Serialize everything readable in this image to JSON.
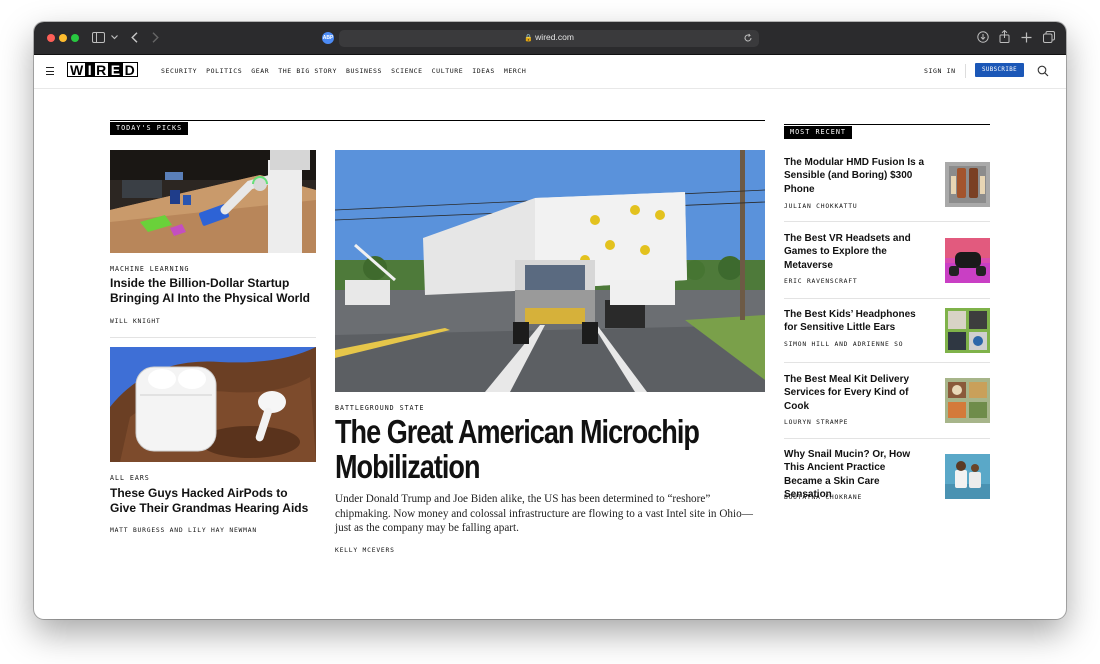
{
  "browser": {
    "url": "wired.com",
    "privacy_badge": "ABP"
  },
  "header": {
    "logo_letters": [
      "W",
      "I",
      "R",
      "E",
      "D"
    ],
    "nav": [
      "SECURITY",
      "POLITICS",
      "GEAR",
      "THE BIG STORY",
      "BUSINESS",
      "SCIENCE",
      "CULTURE",
      "IDEAS",
      "MERCH"
    ],
    "sign_in": "SIGN IN",
    "subscribe": "SUBSCRIBE"
  },
  "todays_picks": {
    "label": "TODAY'S PICKS",
    "stories": [
      {
        "kicker": "MACHINE LEARNING",
        "title": "Inside the Billion-Dollar Startup Bringing AI Into the Physical World",
        "byline": "WILL KNIGHT"
      },
      {
        "kicker": "ALL EARS",
        "title": "These Guys Hacked AirPods to Give Their Grandmas Hearing Aids",
        "byline": "MATT BURGESS AND LILY HAY NEWMAN"
      }
    ]
  },
  "feature": {
    "kicker": "BATTLEGROUND STATE",
    "title": "The Great American Microchip Mobilization",
    "dek": "Under Donald Trump and Joe Biden alike, the US has been determined to “reshore” chipmaking. Now money and colossal infrastructure are flowing to a vast Intel site in Ohio—just as the company may be falling apart.",
    "byline": "KELLY MCEVERS"
  },
  "most_recent": {
    "label": "MOST RECENT",
    "items": [
      {
        "title": "The Modular HMD Fusion Is a Sensible (and Boring) $300 Phone",
        "byline": "JULIAN CHOKKATTU"
      },
      {
        "title": "The Best VR Headsets and Games to Explore the Metaverse",
        "byline": "ERIC RAVENSCRAFT"
      },
      {
        "title": "The Best Kids’ Headphones for Sensitive Little Ears",
        "byline": "SIMON HILL AND ADRIENNE SO"
      },
      {
        "title": "The Best Meal Kit Delivery Services for Every Kind of Cook",
        "byline": "LOURYN STRAMPE"
      },
      {
        "title": "Why Snail Mucin? Or, How This Ancient Practice Became a Skin Care Sensation",
        "byline": "BOUTAYNA CHOKRANE"
      }
    ]
  },
  "colors": {
    "subscribe_bg": "#1b57b7",
    "chrome_bg": "#2b2b2d",
    "tag_bg": "#000000"
  }
}
